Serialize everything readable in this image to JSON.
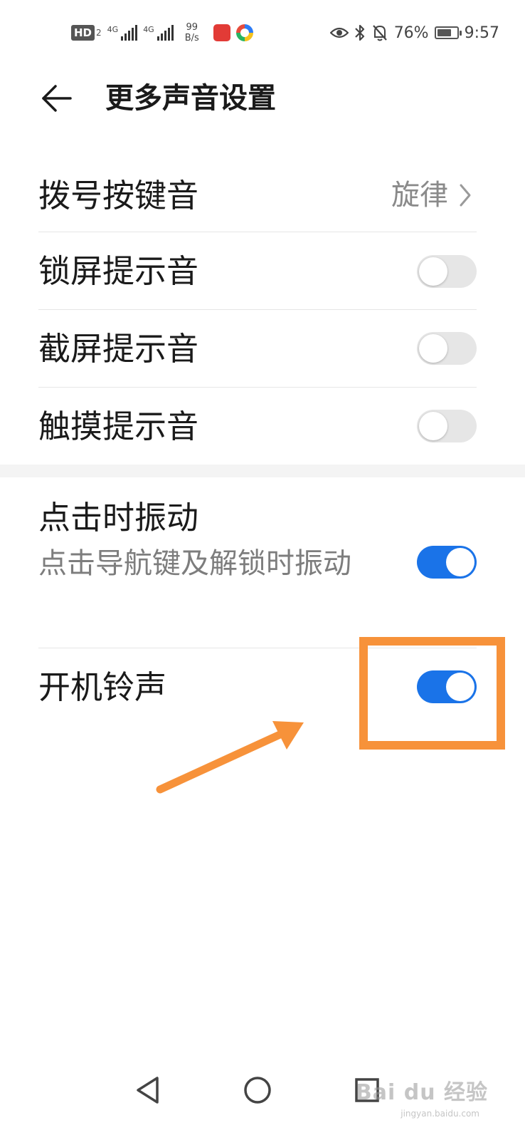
{
  "status_bar": {
    "hd": "HD",
    "sim_number": "2",
    "network_1": "4G",
    "network_2": "4G",
    "speed_value": "99",
    "speed_unit": "B/s",
    "battery_percent": "76%",
    "battery_level": 0.76,
    "time": "9:57"
  },
  "header": {
    "title": "更多声音设置"
  },
  "settings": {
    "dial_tone": {
      "label": "拨号按键音",
      "value": "旋律"
    },
    "lock_sound": {
      "label": "锁屏提示音",
      "enabled": false
    },
    "screenshot_sound": {
      "label": "截屏提示音",
      "enabled": false
    },
    "touch_sound": {
      "label": "触摸提示音",
      "enabled": false
    },
    "tap_vibration": {
      "label": "点击时振动",
      "description": "点击导航键及解锁时振动",
      "enabled": true
    },
    "boot_ringtone": {
      "label": "开机铃声",
      "enabled": true
    }
  },
  "watermark": {
    "brand": "Bai du 经验",
    "url": "jingyan.baidu.com"
  },
  "colors": {
    "accent": "#1a73e8",
    "annotation": "#f7923a",
    "toggle_off": "#e6e6e6"
  }
}
